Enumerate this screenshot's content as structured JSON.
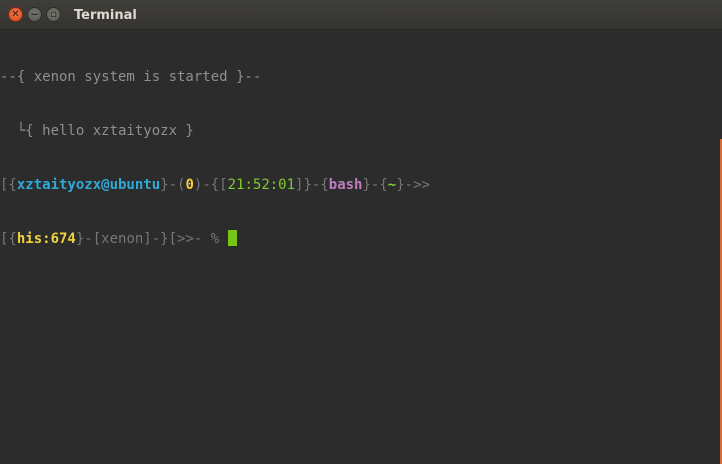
{
  "window": {
    "title": "Terminal",
    "close_glyph": "✕",
    "min_glyph": "‒",
    "max_glyph": "▫"
  },
  "terminal": {
    "line1": "--{ xenon system is started }--",
    "line2": "  └{ hello xztaityozx }",
    "prompt1": {
      "b1": "[{",
      "user_host": "xztaityozx@ubuntu",
      "b2": "}-(",
      "exit_code": "0",
      "b3": ")-{[",
      "time": "21:52:01",
      "b4": "]}-{",
      "shell": "bash",
      "b5": "}-{",
      "cwd": "~",
      "b6": "}->>"
    },
    "prompt2": {
      "b1": "[{",
      "history": "his:674",
      "b2": "}-[xenon]-}[>>- %"
    }
  },
  "colors": {
    "prompt_user": "#31a9d6",
    "prompt_exit": "#f0d33b",
    "prompt_time": "#7fcb32",
    "prompt_shell": "#c07ec0",
    "cursor": "#74c514"
  }
}
